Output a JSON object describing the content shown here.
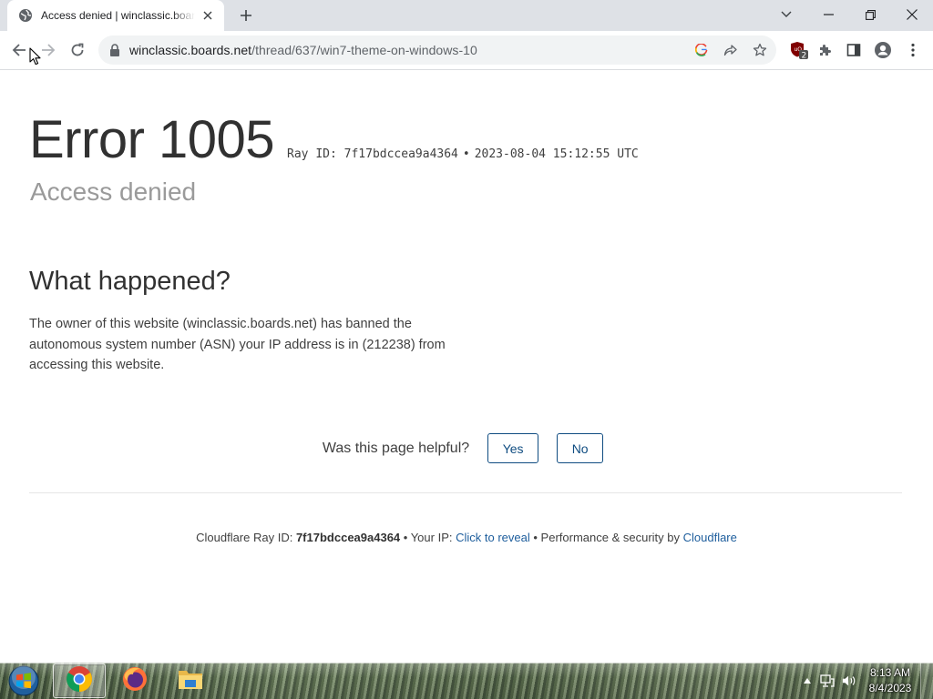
{
  "browser": {
    "tab_title": "Access denied | winclassic.boards.net",
    "url_host": "winclassic.boards.net",
    "url_path": "/thread/637/win7-theme-on-windows-10",
    "extension_badge": "2"
  },
  "page": {
    "error_title": "Error 1005",
    "ray_id_text": "Ray ID: 7f17bdccea9a4364",
    "bullet": "•",
    "timestamp": "2023-08-04 15:12:55 UTC",
    "subtitle": "Access denied",
    "heading": "What happened?",
    "paragraph": "The owner of this website (winclassic.boards.net) has banned the autonomous system number (ASN) your IP address is in (212238) from accessing this website.",
    "helpful": {
      "question": "Was this page helpful?",
      "yes": "Yes",
      "no": "No"
    },
    "footer": {
      "ray_label": "Cloudflare Ray ID:",
      "ray_value": "7f17bdccea9a4364",
      "ip_label": "• Your IP:",
      "reveal_link": "Click to reveal",
      "perf_label": "• Performance & security by",
      "cloudflare_link": "Cloudflare"
    }
  },
  "taskbar": {
    "time": "8:13 AM",
    "date": "8/4/2023",
    "items": [
      "chrome-icon",
      "firefox-icon",
      "file-explorer-icon"
    ]
  },
  "colors": {
    "link": "#1d5d9c",
    "button_border": "#0f4c81",
    "tabstrip": "#dee1e6",
    "omnibox": "#f1f3f4"
  }
}
